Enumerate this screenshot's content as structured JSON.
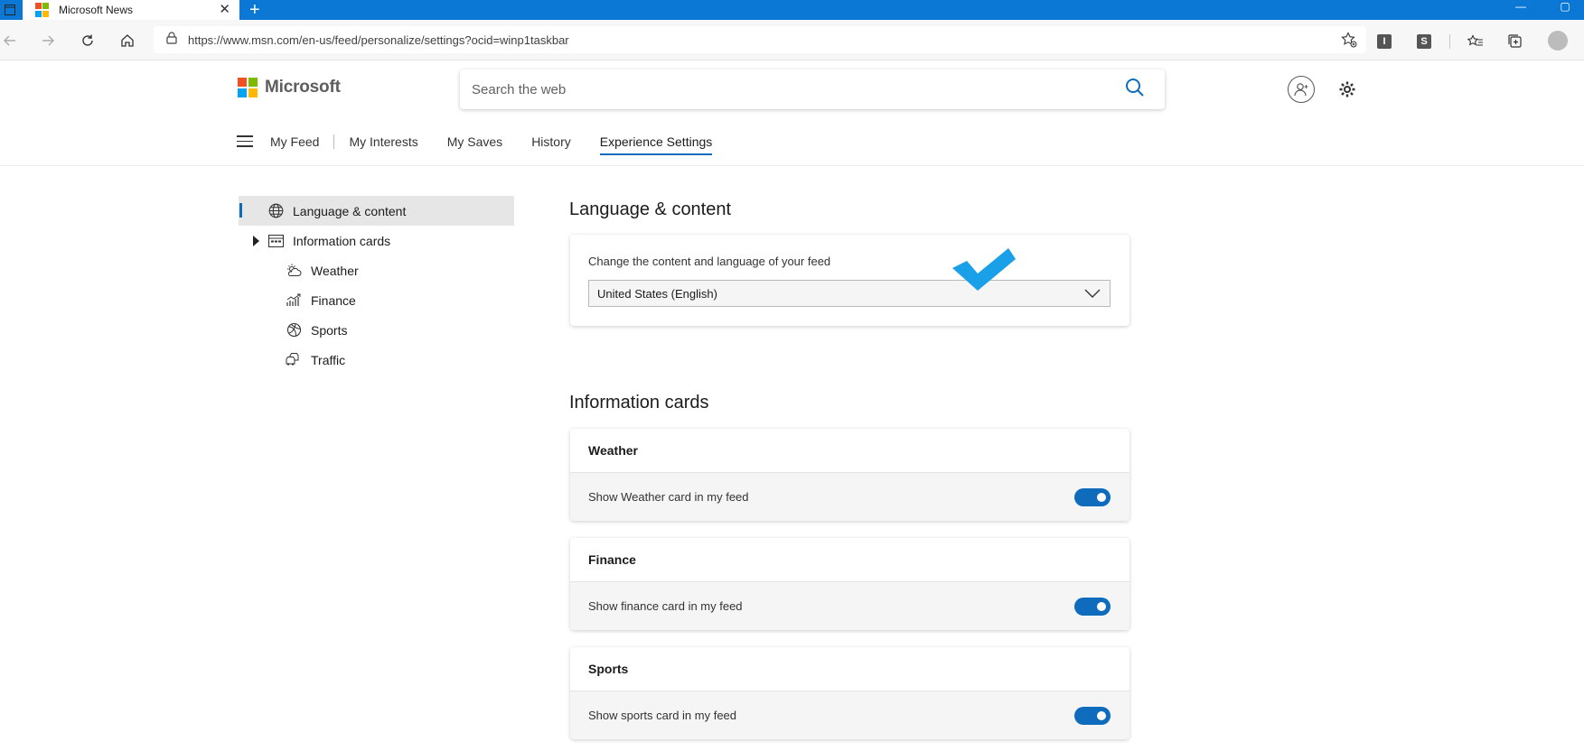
{
  "browser": {
    "tab_title": "Microsoft News",
    "url": "https://www.msn.com/en-us/feed/personalize/settings?ocid=winp1taskbar",
    "extensions": [
      "I",
      "S"
    ]
  },
  "header": {
    "brand": "Microsoft",
    "search_placeholder": "Search the web"
  },
  "nav": {
    "tabs": [
      {
        "label": "My Feed"
      },
      {
        "label": "My Interests"
      },
      {
        "label": "My Saves"
      },
      {
        "label": "History"
      },
      {
        "label": "Experience Settings",
        "active": true
      }
    ]
  },
  "sidebar": {
    "items": [
      {
        "label": "Language & content",
        "icon": "globe-icon",
        "active": true
      },
      {
        "label": "Information cards",
        "icon": "cards-icon"
      },
      {
        "label": "Weather",
        "icon": "weather-icon"
      },
      {
        "label": "Finance",
        "icon": "finance-icon"
      },
      {
        "label": "Sports",
        "icon": "sports-icon"
      },
      {
        "label": "Traffic",
        "icon": "traffic-icon"
      }
    ]
  },
  "language": {
    "title": "Language & content",
    "label": "Change the content and language of your feed",
    "selected": "United States (English)"
  },
  "info_cards": {
    "title": "Information cards",
    "cards": [
      {
        "title": "Weather",
        "toggle_label": "Show Weather card in my feed",
        "enabled": true
      },
      {
        "title": "Finance",
        "toggle_label": "Show finance card in my feed",
        "enabled": true
      },
      {
        "title": "Sports",
        "toggle_label": "Show sports card in my feed",
        "enabled": true
      }
    ]
  },
  "colors": {
    "accent": "#0f6cbd",
    "titlebar": "#0a78d4",
    "checkmark": "#1aa0e8"
  }
}
